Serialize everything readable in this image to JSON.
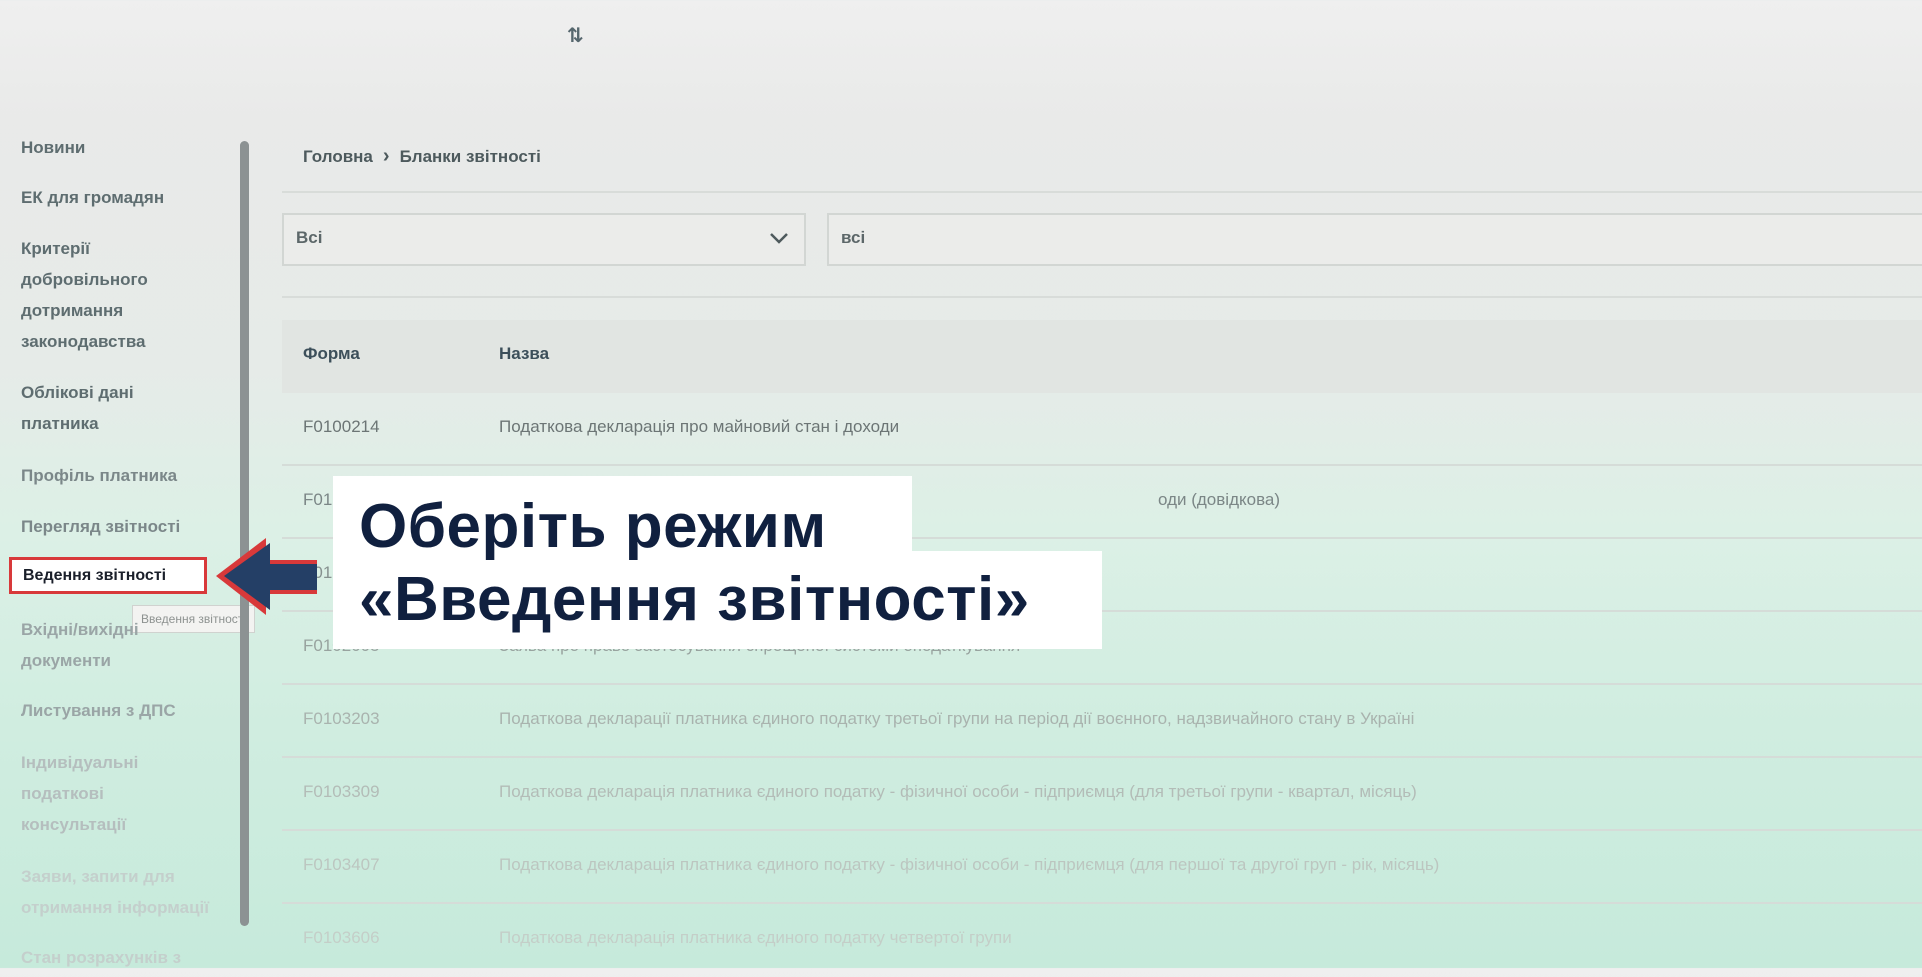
{
  "sidebar": {
    "items": [
      {
        "label": "Новини"
      },
      {
        "label": "ЕК для громадян"
      },
      {
        "label": "Критерії добровільного дотримання законодавства"
      },
      {
        "label": "Облікові дані платника"
      },
      {
        "label": "Профіль платника"
      },
      {
        "label": "Перегляд звітності"
      },
      {
        "label": "Ведення звітності"
      },
      {
        "label": "Вхідні/вихідні документи"
      },
      {
        "label": "Листування з ДПС"
      },
      {
        "label": "Індивідуальні податкові консультації"
      },
      {
        "label": "Заяви, запити для отримання інформації"
      },
      {
        "label": "Стан розрахунків з"
      }
    ],
    "tooltip": "Введення звітності"
  },
  "breadcrumb": {
    "home": "Головна",
    "current": "Бланки звітності"
  },
  "filters": {
    "select_value": "Всі",
    "search_value": "всі"
  },
  "table": {
    "columns": [
      "Форма",
      "Назва"
    ],
    "rows": [
      {
        "code": "F0100214",
        "name": "Податкова декларація про майновий стан і доходи"
      },
      {
        "code": "F01",
        "name": "оди (довідкова)"
      },
      {
        "code": "F01",
        "name": ""
      },
      {
        "code": "F0102005",
        "name": "Заява про право застосування спрощеної системи оподаткування"
      },
      {
        "code": "F0103203",
        "name": "Податкова декларації платника єдиного податку третьої групи на період дії воєнного, надзвичайного стану в Україні"
      },
      {
        "code": "F0103309",
        "name": "Податкова декларація платника єдиного податку - фізичної особи - підприємця (для третьої групи - квартал, місяць)"
      },
      {
        "code": "F0103407",
        "name": "Податкова декларація платника єдиного податку - фізичної особи - підприємця (для першої та другої груп - рік, місяць)"
      },
      {
        "code": "F0103606",
        "name": "Податкова декларація платника єдиного податку четвертої групи"
      }
    ]
  },
  "callout": {
    "line1": "Оберіть режим",
    "line2": "«Введення звітності»"
  },
  "colors": {
    "highlight_border": "#d8393a",
    "arrow_fill": "#243f66",
    "callout_text": "#10203f"
  }
}
